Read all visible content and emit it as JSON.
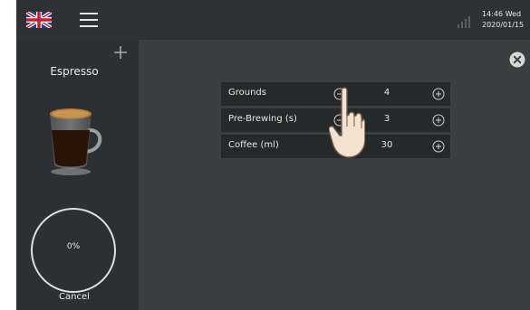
{
  "header": {
    "flag_icon": "uk-flag-icon",
    "menu_icon": "hamburger-menu-icon",
    "signal_icon": "signal-strength-icon",
    "time": "14:46 Wed",
    "date": "2020/01/15"
  },
  "sidebar": {
    "add_icon": "plus-icon",
    "product_name": "Espresso",
    "product_image": "espresso-cup-icon",
    "progress_text": "0%",
    "progress": 0,
    "cancel_label": "Cancel"
  },
  "main": {
    "close_icon": "close-icon",
    "rows": [
      {
        "label": "Grounds",
        "value": "4"
      },
      {
        "label": "Pre-Brewing (s)",
        "value": "3"
      },
      {
        "label": "Coffee (ml)",
        "value": "30"
      }
    ]
  },
  "colors": {
    "background": "#2c3032",
    "panel": "#3a3f40",
    "row": "#25292a",
    "text": "#e6e6e6"
  }
}
